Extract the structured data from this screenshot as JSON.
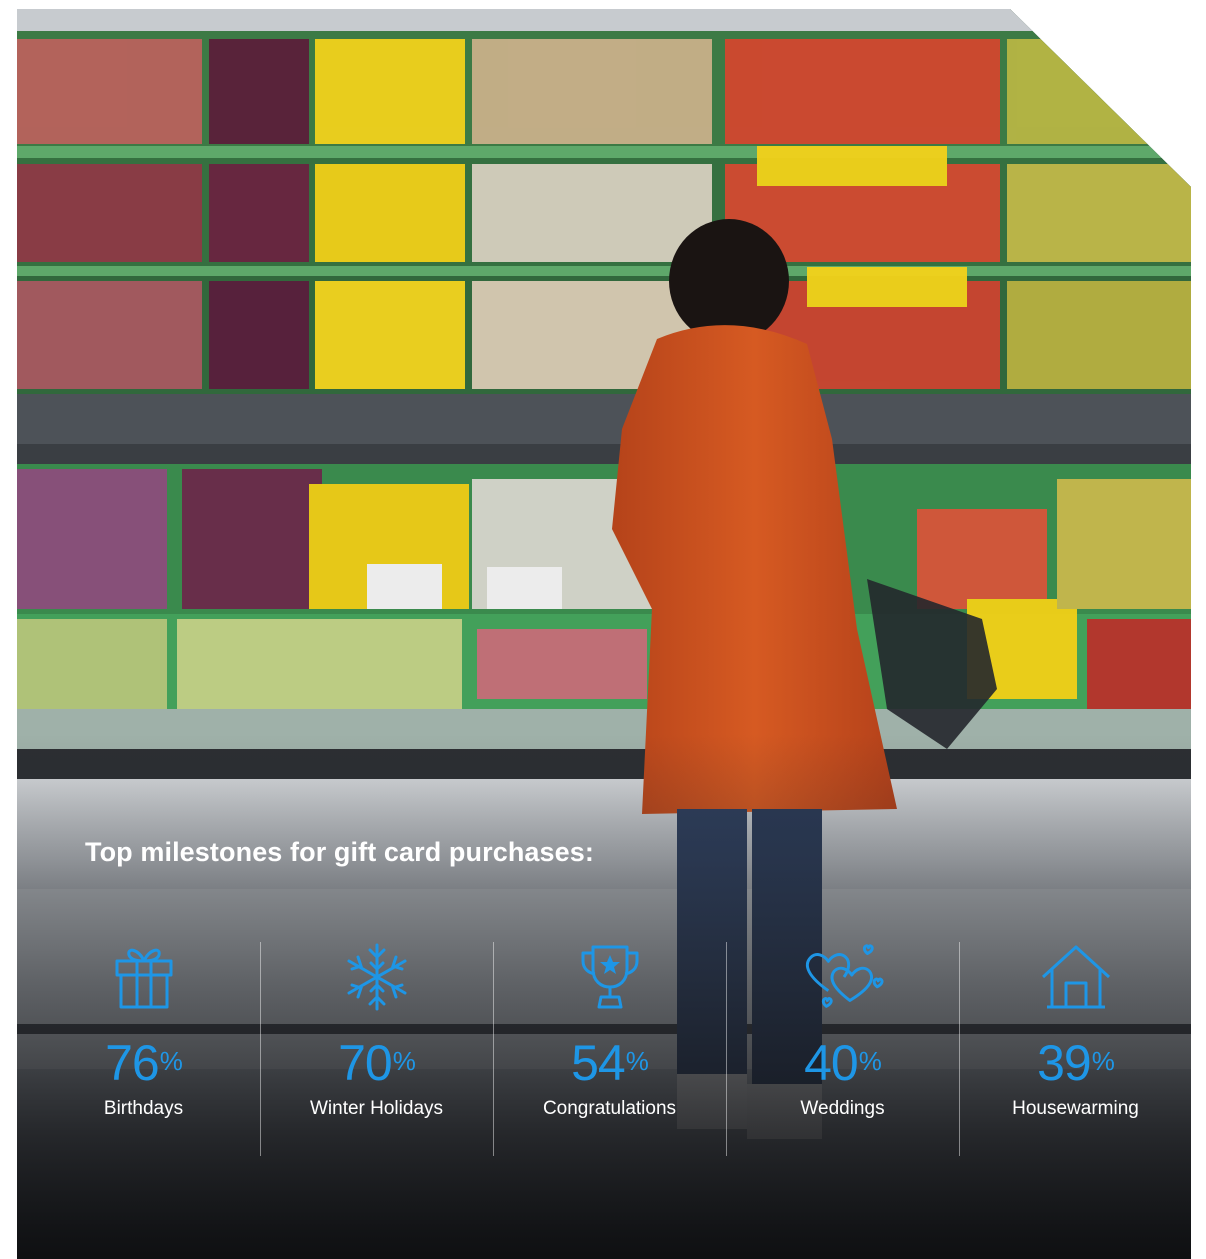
{
  "headline": "Top milestones for gift card purchases:",
  "accent_color": "#1e96e6",
  "stats": [
    {
      "icon": "gift-icon",
      "value": "76",
      "unit": "%",
      "label": "Birthdays"
    },
    {
      "icon": "snowflake-icon",
      "value": "70",
      "unit": "%",
      "label": "Winter Holidays"
    },
    {
      "icon": "trophy-icon",
      "value": "54",
      "unit": "%",
      "label": "Congratulations"
    },
    {
      "icon": "hearts-icon",
      "value": "40",
      "unit": "%",
      "label": "Weddings"
    },
    {
      "icon": "house-icon",
      "value": "39",
      "unit": "%",
      "label": "Housewarming"
    }
  ]
}
